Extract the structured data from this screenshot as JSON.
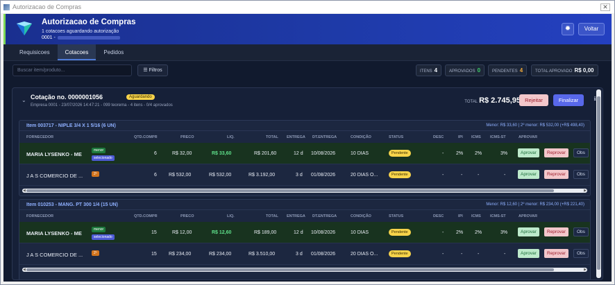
{
  "window": {
    "title": "Autorizacao de Compras"
  },
  "header": {
    "title": "Autorizacao de Compras",
    "subtitle": "1 cotacoes aguardando autorização",
    "code": "0001 -",
    "theme_icon": "sun-icon",
    "voltar_label": "Voltar"
  },
  "tabs": [
    {
      "label": "Requisicoes"
    },
    {
      "label": "Cotacoes",
      "active": true
    },
    {
      "label": "Pedidos"
    }
  ],
  "toolbar": {
    "search_placeholder": "Buscar item/produto...",
    "filtros_label": "Filtros",
    "stats": {
      "itens_label": "ITENS",
      "itens_value": "4",
      "aprovados_label": "APROVADOS",
      "aprovados_value": "0",
      "pendentes_label": "PENDENTES",
      "pendentes_value": "4",
      "total_label": "TOTAL APROVADO",
      "total_value": "R$ 0,00"
    }
  },
  "quote": {
    "title": "Cotação no. 0000001056",
    "status": "Aguardando",
    "meta": "Empresa 0001 - 23/07/2026 14:47:21 - 099 teorema - 4 itens - 0/4 aprovados",
    "total_label": "TOTAL",
    "total_value": "R$ 2.745,95",
    "rejeitar_label": "Rejeitar",
    "finalizar_label": "Finalizar",
    "info_icon": "info-icon"
  },
  "columns": {
    "fornecedor": "FORNECEDOR",
    "qtd": "QTD.COMPR",
    "preco": "PRECO",
    "liq": "LIQ.",
    "total": "TOTAL",
    "entrega": "ENTREGA",
    "dtentrega": "DT.ENTREGA",
    "condicao": "CONDIÇÃO",
    "status": "STATUS",
    "desc": "DESC",
    "ipi": "IPI",
    "icms": "ICMS",
    "icmsst": "ICMS-ST",
    "aprovar": "APROVAR"
  },
  "items": [
    {
      "title": "Item 003717 - NIPLE 3/4 X 1 5/16 (6 UN)",
      "minor": "Menor: R$ 33,60 | 2º menor: R$ 532,00 (+R$ 498,40)",
      "rows": [
        {
          "fornecedor": "MARIA LYSENKO - ME",
          "tag1": "menor",
          "tag2": "selecionado",
          "qtd": "6",
          "preco": "R$ 32,00",
          "liq": "R$ 33,60",
          "total": "R$ 201,60",
          "entrega": "12 d",
          "dtentrega": "10/08/2026",
          "condicao": "10 DIAS",
          "status": "Pendente",
          "desc": "-",
          "ipi": "2%",
          "icms": "2%",
          "icmsst": "3%",
          "aprovar": "Aprovar",
          "reprovar": "Reprovar",
          "obs": "Obs"
        },
        {
          "fornecedor": "J A S COMERCIO DE ...",
          "tag1": "2º",
          "qtd": "6",
          "preco": "R$ 532,00",
          "liq": "R$ 532,00",
          "total": "R$ 3.192,00",
          "entrega": "3 d",
          "dtentrega": "01/08/2026",
          "condicao": "20 DIAS O...",
          "status": "Pendente",
          "desc": "-",
          "ipi": "-",
          "icms": "-",
          "icmsst": "-",
          "aprovar": "Aprovar",
          "reprovar": "Reprovar",
          "obs": "Obs"
        }
      ]
    },
    {
      "title": "Item 010253 - MANG. PT 300 1/4 (15 UN)",
      "minor": "Menor: R$ 12,60 | 2º menor: R$ 234,00 (+R$ 221,40)",
      "rows": [
        {
          "fornecedor": "MARIA LYSENKO - ME",
          "tag1": "menor",
          "tag2": "selecionado",
          "qtd": "15",
          "preco": "R$ 12,00",
          "liq": "R$ 12,60",
          "total": "R$ 189,00",
          "entrega": "12 d",
          "dtentrega": "10/08/2026",
          "condicao": "10 DIAS",
          "status": "Pendente",
          "desc": "-",
          "ipi": "2%",
          "icms": "2%",
          "icmsst": "3%",
          "aprovar": "Aprovar",
          "reprovar": "Reprovar",
          "obs": "Obs"
        },
        {
          "fornecedor": "J A S COMERCIO DE ...",
          "tag1": "2º",
          "qtd": "15",
          "preco": "R$ 234,00",
          "liq": "R$ 234,00",
          "total": "R$ 3.510,00",
          "entrega": "3 d",
          "dtentrega": "01/08/2026",
          "condicao": "20 DIAS O...",
          "status": "Pendente",
          "desc": "-",
          "ipi": "-",
          "icms": "-",
          "icmsst": "-",
          "aprovar": "Aprovar",
          "reprovar": "Reprovar",
          "obs": "Obs"
        }
      ]
    }
  ],
  "colors": {
    "accent": "#1e3aa8",
    "success": "#3ecf6a",
    "warning": "#f7d34a",
    "danger": "#f3c7cb"
  }
}
